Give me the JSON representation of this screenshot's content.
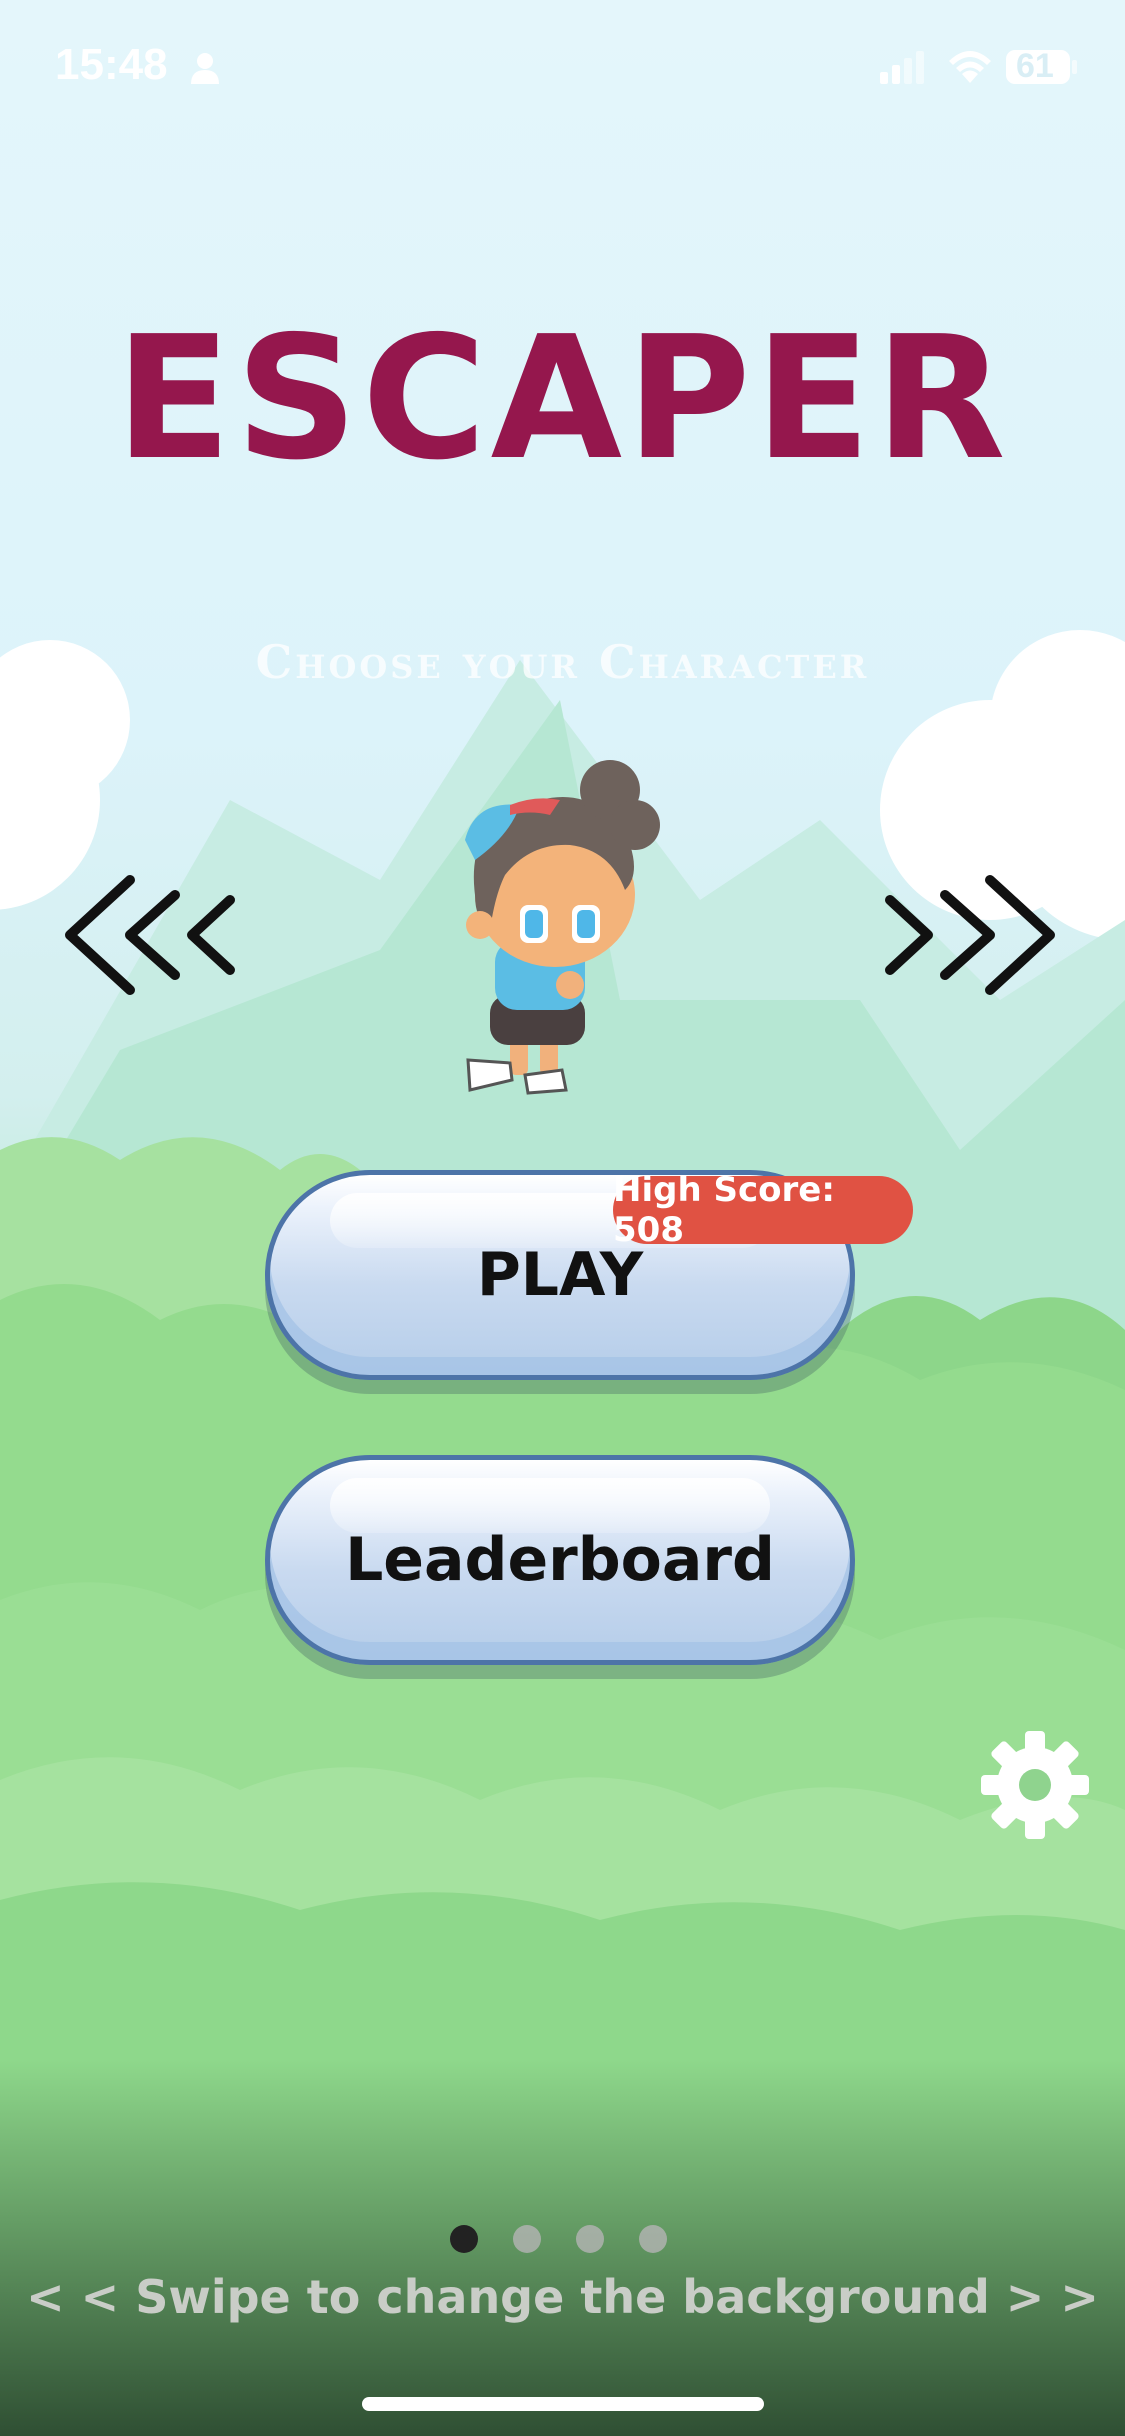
{
  "status_bar": {
    "time": "15:48",
    "battery": "61",
    "icons": [
      "person-icon",
      "signal-icon",
      "wifi-icon",
      "battery-icon"
    ]
  },
  "title": "ESCAPER",
  "subtitle": "Choose your Character",
  "nav": {
    "prev_icon": "triple-chevron-left-icon",
    "next_icon": "triple-chevron-right-icon"
  },
  "buttons": {
    "play": "PLAY",
    "leaderboard": "Leaderboard"
  },
  "high_score": "High Score: 508",
  "settings_icon": "gear-icon",
  "pagination": {
    "total": 4,
    "active": 1
  },
  "swipe_hint": "< < Swipe to change the background > >",
  "colors": {
    "title": "#95174d",
    "high_score_badge": "#e05243",
    "button_border": "#4d74a8"
  }
}
